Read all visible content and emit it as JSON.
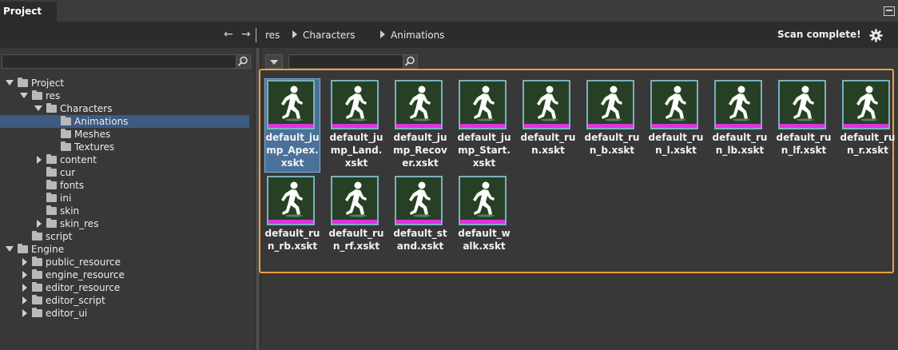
{
  "window": {
    "tab_title": "Project"
  },
  "toolbar": {
    "back_icon": "back-arrow-icon",
    "forward_icon": "forward-arrow-icon",
    "breadcrumb": [
      "res",
      "Characters",
      "Animations"
    ],
    "status": "Scan complete!",
    "settings_icon": "gear-icon"
  },
  "left_search": {
    "value": "",
    "placeholder": ""
  },
  "right_search": {
    "value": "",
    "placeholder": ""
  },
  "tree": [
    {
      "label": "Project",
      "expanded": true
    },
    {
      "label": "res",
      "expanded": true
    },
    {
      "label": "Characters",
      "expanded": true
    },
    {
      "label": "Animations",
      "selected": true
    },
    {
      "label": "Meshes"
    },
    {
      "label": "Textures"
    },
    {
      "label": "content",
      "expanded": false
    },
    {
      "label": "cur"
    },
    {
      "label": "fonts"
    },
    {
      "label": "ini"
    },
    {
      "label": "skin"
    },
    {
      "label": "skin_res",
      "expanded": false
    },
    {
      "label": "script"
    },
    {
      "label": "Engine",
      "expanded": true
    },
    {
      "label": "public_resource",
      "expanded": false
    },
    {
      "label": "engine_resource",
      "expanded": false
    },
    {
      "label": "editor_resource",
      "expanded": false
    },
    {
      "label": "editor_script",
      "expanded": false
    },
    {
      "label": "editor_ui",
      "expanded": false
    }
  ],
  "files": [
    {
      "name": "default_jump_Apex.xskt",
      "selected": true
    },
    {
      "name": "default_jump_Land.xskt"
    },
    {
      "name": "default_jump_Recover.xskt"
    },
    {
      "name": "default_jump_Start.xskt"
    },
    {
      "name": "default_run.xskt"
    },
    {
      "name": "default_run_b.xskt"
    },
    {
      "name": "default_run_l.xskt"
    },
    {
      "name": "default_run_lb.xskt"
    },
    {
      "name": "default_run_lf.xskt"
    },
    {
      "name": "default_run_r.xskt"
    },
    {
      "name": "default_run_rb.xskt"
    },
    {
      "name": "default_run_rf.xskt"
    },
    {
      "name": "default_stand.xskt"
    },
    {
      "name": "default_walk.xskt"
    }
  ],
  "colors": {
    "selection": "#3d5a80",
    "highlight_border": "#f0a040",
    "thumb_bar": "#e031e0",
    "thumb_bg": "#274025"
  }
}
